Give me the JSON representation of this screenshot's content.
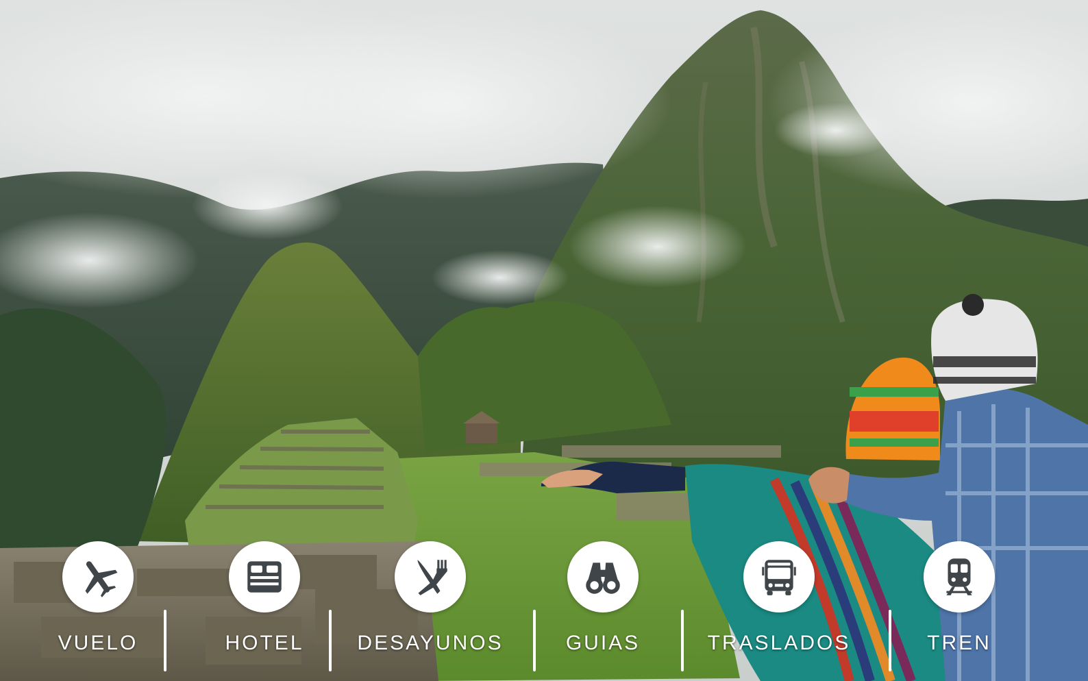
{
  "features": [
    {
      "label": "VUELO",
      "icon": "airplane-icon"
    },
    {
      "label": "HOTEL",
      "icon": "bed-icon"
    },
    {
      "label": "DESAYUNOS",
      "icon": "fork-knife-icon"
    },
    {
      "label": "GUIAS",
      "icon": "binoculars-icon"
    },
    {
      "label": "TRASLADOS",
      "icon": "bus-icon"
    },
    {
      "label": "TREN",
      "icon": "train-icon"
    }
  ],
  "colors": {
    "icon": "#3f4548",
    "circle": "#ffffff",
    "label": "#ffffff",
    "sky": "#e4e6e5",
    "mountain": "#4f6a3f",
    "grass": "#6f9a3a",
    "stone": "#7a7462"
  }
}
